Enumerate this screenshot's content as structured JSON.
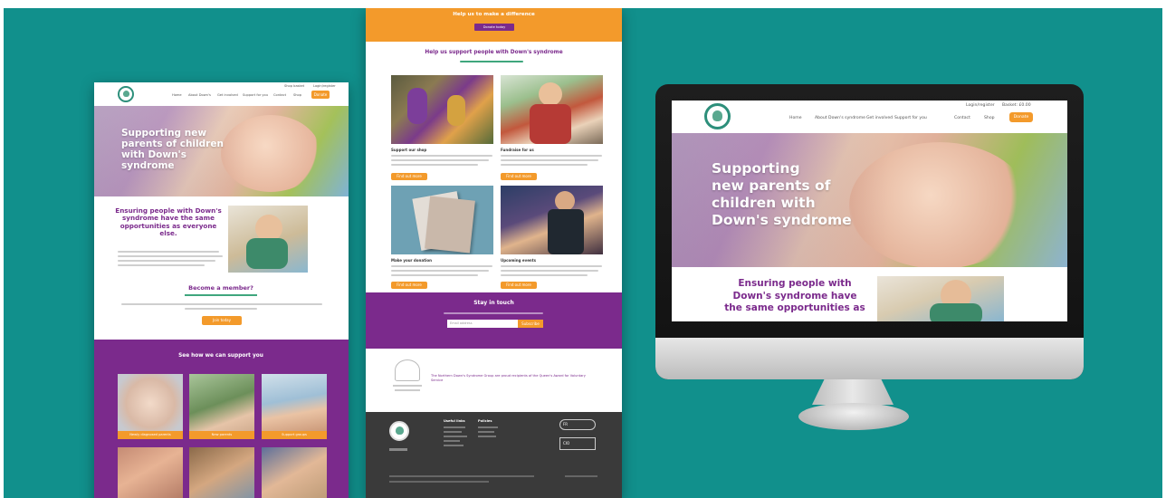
{
  "left_mock": {
    "nav": {
      "top_links": [
        "Shop basket",
        "Login/register"
      ],
      "items": [
        "Home",
        "About Down's",
        "Get involved",
        "Support for you",
        "Contact",
        "Shop",
        "Donate"
      ]
    },
    "hero_title": "Supporting new parents of children with Down's syndrome",
    "intro_heading": "Ensuring people with Down's syndrome have the same opportunities as everyone else.",
    "member_heading": "Become a member?",
    "member_button": "Join today",
    "support_heading": "See how we can support you",
    "tiles": [
      {
        "caption": "Newly diagnosed parents"
      },
      {
        "caption": "New parents"
      },
      {
        "caption": "Support groups"
      },
      {
        "caption": ""
      },
      {
        "caption": ""
      },
      {
        "caption": ""
      }
    ]
  },
  "center_mock": {
    "banner_heading": "Help us to make a difference",
    "banner_button": "Donate today",
    "support_heading": "Help us support people with Down's syndrome",
    "cards": [
      {
        "title": "Support our shop",
        "button": "Find out more"
      },
      {
        "title": "Fundraise for us",
        "button": "Find out more"
      },
      {
        "title": "Make your donation",
        "button": "Find out more"
      },
      {
        "title": "Upcoming events",
        "button": "Find out more"
      }
    ],
    "newsletter_heading": "Stay in touch",
    "newsletter_placeholder": "Email address",
    "newsletter_button": "Subscribe",
    "award_text": "The Northern Down's Syndrome Group are proud recipients of the Queen's Award for Voluntary Service",
    "footer_heads": [
      "Useful links",
      "Policies"
    ],
    "footer_badges": [
      "FR",
      "CIO"
    ]
  },
  "monitor_mock": {
    "top_links": [
      "Login/register",
      "Basket: £0.00"
    ],
    "nav": [
      "Home",
      "About Down's syndrome",
      "Get involved",
      "Support for you",
      "Contact",
      "Shop",
      "Donate"
    ],
    "hero_title_lines": [
      "Supporting",
      "new parents of",
      "children  with",
      "Down's syndrome"
    ],
    "intro_heading_lines": [
      "Ensuring people with",
      "Down's syndrome have",
      "the same opportunities as"
    ]
  },
  "colors": {
    "background": "#11908c",
    "brand_purple": "#7b2a8c",
    "brand_orange": "#f39a2b",
    "footer_dark": "#3a3a3a",
    "logo_green": "#2d8f7b"
  }
}
